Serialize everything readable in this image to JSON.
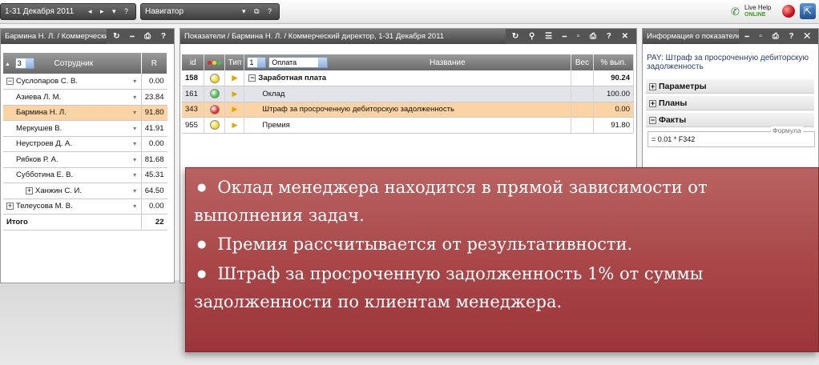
{
  "toolbar": {
    "period": "1-31 Декабря 2011",
    "period_controls": "◂ ▸ ▾ ?",
    "navigator": "Навигатор",
    "navigator_controls": "▾ ⧉ ?",
    "live_help_line1": "Live Help",
    "live_help_line2": "ONLINE"
  },
  "left_panel": {
    "title": "Бармина Н. Л. / Коммерческий ,",
    "controls": "↻ ⎯ ⎙ ?",
    "level": "3",
    "col_employee": "Сотрудник",
    "col_r": "R",
    "rows": [
      {
        "name": "Суслопаров С. В.",
        "value": "0.00",
        "expand": "⊟"
      },
      {
        "name": "Азиева Л. М.",
        "value": "23.84"
      },
      {
        "name": "Бармина Н. Л.",
        "value": "91.80",
        "selected": true
      },
      {
        "name": "Меркушев В.",
        "value": "41.91"
      },
      {
        "name": "Неустроев Д. А.",
        "value": "0.00"
      },
      {
        "name": "Рябков Р. А.",
        "value": "81.68"
      },
      {
        "name": "Субботина Е. В.",
        "value": "45.31"
      },
      {
        "name": "Ханжин С. И.",
        "value": "64.50",
        "expand": "⊞"
      },
      {
        "name": "Телеусова М. В.",
        "value": "0.00",
        "expand": "⊞"
      }
    ],
    "total_label": "Итого",
    "total_value": "22"
  },
  "middle_panel": {
    "title": "Показатели / Бармина Н. Л. / Коммерческий директор, 1-31 Декабря 2011",
    "controls": "↻ ⚲ ☰ ⎯ ▫ ⎙ ? ✕",
    "col_id": "id",
    "col_type": "Тип",
    "group_level": "1",
    "group_value": "Оплата",
    "col_name": "Название",
    "col_weight": "Вес",
    "col_exec": "% вып.",
    "rows": [
      {
        "id": "158",
        "status": "yellow",
        "name": "Заработная плата",
        "weight": "",
        "exec": "90.24",
        "group": true
      },
      {
        "id": "161",
        "status": "green",
        "name": "Оклад",
        "weight": "",
        "exec": "100.00",
        "alt": true
      },
      {
        "id": "343",
        "status": "red",
        "name": "Штраф за просроченную дебиторскую задолженность",
        "weight": "",
        "exec": "0.00",
        "selected": true
      },
      {
        "id": "955",
        "status": "yellow",
        "name": "Премия",
        "weight": "",
        "exec": "91.80"
      }
    ]
  },
  "right_panel": {
    "title": "Информация о показателе",
    "controls": "⎯ ▫ ⎙ ? ✕",
    "indicator_title": "PAY: Штраф за просроченную дебиторскую задолженность",
    "section_params": "Параметры",
    "section_plans": "Планы",
    "section_facts": "Факты",
    "formula_label": "Формула",
    "formula": "= 0.01 * F342"
  },
  "callout": {
    "items": [
      "Оклад менеджера находится в прямой зависимости от выполнения задач.",
      "Премия рассчитывается от результативности.",
      "Штраф за просроченную задолженность 1% от суммы задолженности по клиентам менеджера."
    ]
  },
  "colors": {
    "selected_row": "#fcd3a5",
    "header_dark": "#4f4f4f",
    "callout_bg": "#a94749",
    "status_green": "#3fc63f",
    "status_yellow": "#f7d51a",
    "status_red": "#e3262c"
  }
}
